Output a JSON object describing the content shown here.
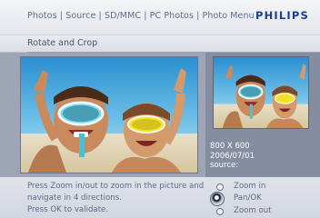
{
  "header": {
    "breadcrumb": "Photos | Source | SD/MMC | PC Photos  | Photo Menu",
    "brand": "PHILIPS"
  },
  "subheader": {
    "title": "Rotate and Crop"
  },
  "preview": {
    "resolution": "800 X 600",
    "date": "2006/07/01",
    "source_label": "source:"
  },
  "help": {
    "line1": "Press Zoom in/out to zoom in the picture and",
    "line2": "navigate in 4 directions.",
    "line3": "Press OK to validate."
  },
  "controls": {
    "zoom_in": "Zoom in",
    "pan_ok": "Pan/OK",
    "zoom_out": "Zoom out"
  },
  "colors": {
    "brand": "#1c3f8a",
    "panel": "#9ea5b6",
    "side_panel": "#858da1"
  }
}
